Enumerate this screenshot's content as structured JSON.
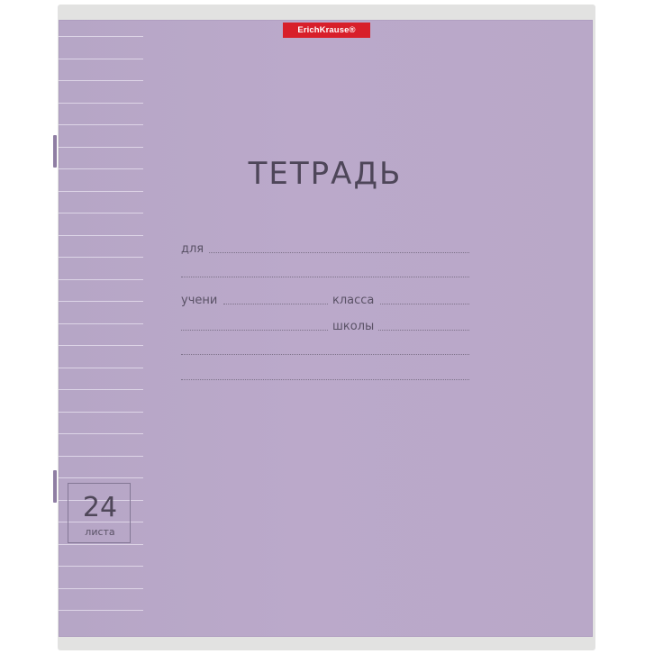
{
  "brand": {
    "name": "ErichKrause®"
  },
  "cover": {
    "title": "ТЕТРАДЬ",
    "fields": {
      "for_label": "для",
      "student_label": "учени",
      "class_label": "класса",
      "school_label": "школы"
    },
    "sheet_count": {
      "number": "24",
      "word": "листа"
    }
  },
  "colors": {
    "cover": "#b9a8c8",
    "brand_red": "#d81f2a",
    "text": "#4e4659",
    "sleeve": "#e2e2e1"
  }
}
